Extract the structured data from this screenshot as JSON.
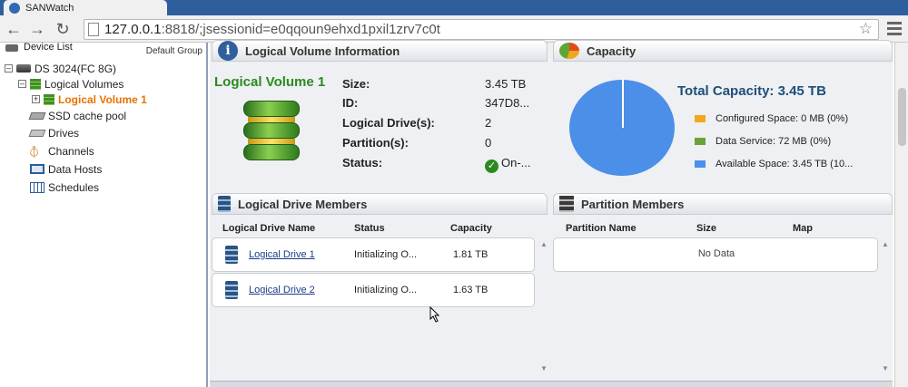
{
  "browser": {
    "tab_title": "SANWatch",
    "url_host": "127.0.0.1",
    "url_rest": ":8818/;jsessionid=e0qqoun9ehxd1pxil1zrv7c0t"
  },
  "device_list": {
    "title": "Device List",
    "group_label": "Default Group",
    "items": [
      {
        "label": "DS 3024(FC 8G)",
        "icon": "storage-device-icon"
      },
      {
        "label": "Logical Volumes",
        "icon": "logical-volumes-icon"
      },
      {
        "label": "Logical Volume 1",
        "icon": "logical-volume-icon"
      },
      {
        "label": "SSD cache pool",
        "icon": "ssd-icon"
      },
      {
        "label": "Drives",
        "icon": "drive-icon"
      },
      {
        "label": "Channels",
        "icon": "channel-icon"
      },
      {
        "label": "Data Hosts",
        "icon": "host-icon"
      },
      {
        "label": "Schedules",
        "icon": "calendar-icon"
      }
    ]
  },
  "lv_info": {
    "title": "Logical Volume Information",
    "name": "Logical Volume 1",
    "rows": [
      {
        "key": "Size:",
        "value": "3.45 TB"
      },
      {
        "key": "ID:",
        "value": "347D8..."
      },
      {
        "key": "Logical Drive(s):",
        "value": "2"
      },
      {
        "key": "Partition(s):",
        "value": "0"
      },
      {
        "key": "Status:",
        "value": "On-..."
      }
    ]
  },
  "capacity": {
    "title": "Capacity",
    "total": "Total Capacity: 3.45 TB",
    "legend": [
      {
        "label": "Configured Space: 0 MB (0%)",
        "color": "#f2a81d"
      },
      {
        "label": "Data Service: 72 MB (0%)",
        "color": "#6aa337"
      },
      {
        "label": "Available Space: 3.45 TB (10...",
        "color": "#4c8fe8"
      }
    ]
  },
  "ld_members": {
    "title": "Logical Drive Members",
    "columns": [
      "Logical Drive Name",
      "Status",
      "Capacity"
    ],
    "rows": [
      {
        "name": "Logical Drive 1",
        "status": "Initializing O...",
        "capacity": "1.81 TB"
      },
      {
        "name": "Logical Drive 2",
        "status": "Initializing O...",
        "capacity": "1.63 TB"
      }
    ]
  },
  "partition_members": {
    "title": "Partition Members",
    "columns": [
      "Partition Name",
      "Size",
      "Map"
    ],
    "empty_text": "No Data"
  }
}
